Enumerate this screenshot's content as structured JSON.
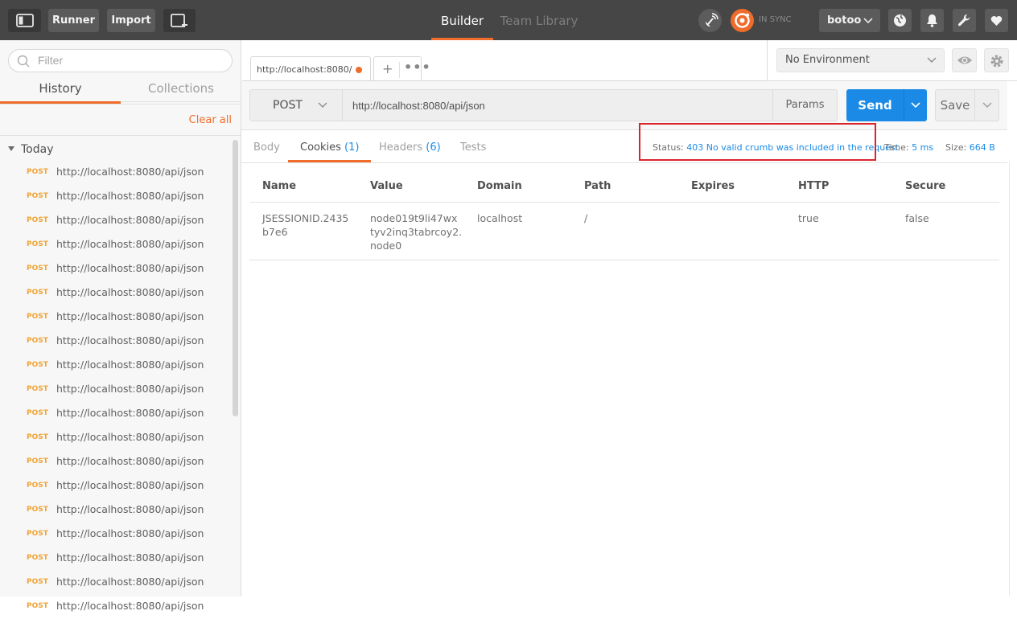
{
  "topbar": {
    "runner_label": "Runner",
    "import_label": "Import",
    "nav_tabs": [
      {
        "label": "Builder",
        "active": true
      },
      {
        "label": "Team Library",
        "active": false
      }
    ],
    "sync_label": "IN SYNC",
    "user_label": "botoo",
    "icons": [
      "sidebar-toggle-icon",
      "new-window-icon",
      "satellite-icon",
      "sync-icon",
      "globe-icon",
      "bell-icon",
      "wrench-icon",
      "heart-icon"
    ]
  },
  "sidebar": {
    "filter_placeholder": "Filter",
    "tabs": [
      {
        "label": "History",
        "active": true
      },
      {
        "label": "Collections",
        "active": false
      }
    ],
    "clear_all_label": "Clear all",
    "group_label": "Today",
    "history": [
      {
        "method": "POST",
        "url": "http://localhost:8080/api/json"
      },
      {
        "method": "POST",
        "url": "http://localhost:8080/api/json"
      },
      {
        "method": "POST",
        "url": "http://localhost:8080/api/json"
      },
      {
        "method": "POST",
        "url": "http://localhost:8080/api/json"
      },
      {
        "method": "POST",
        "url": "http://localhost:8080/api/json"
      },
      {
        "method": "POST",
        "url": "http://localhost:8080/api/json"
      },
      {
        "method": "POST",
        "url": "http://localhost:8080/api/json"
      },
      {
        "method": "POST",
        "url": "http://localhost:8080/api/json"
      },
      {
        "method": "POST",
        "url": "http://localhost:8080/api/json"
      },
      {
        "method": "POST",
        "url": "http://localhost:8080/api/json"
      },
      {
        "method": "POST",
        "url": "http://localhost:8080/api/json"
      },
      {
        "method": "POST",
        "url": "http://localhost:8080/api/json"
      },
      {
        "method": "POST",
        "url": "http://localhost:8080/api/json"
      },
      {
        "method": "POST",
        "url": "http://localhost:8080/api/json"
      },
      {
        "method": "POST",
        "url": "http://localhost:8080/api/json"
      },
      {
        "method": "POST",
        "url": "http://localhost:8080/api/json"
      },
      {
        "method": "POST",
        "url": "http://localhost:8080/api/json"
      },
      {
        "method": "POST",
        "url": "http://localhost:8080/api/json"
      },
      {
        "method": "POST",
        "url": "http://localhost:8080/api/json"
      }
    ]
  },
  "request": {
    "tab_label": "http://localhost:8080/",
    "new_tab_label": "+",
    "more_tabs_label": "•••",
    "method": "POST",
    "url": "http://localhost:8080/api/json",
    "params_label": "Params",
    "send_label": "Send",
    "save_label": "Save"
  },
  "environment": {
    "selected": "No Environment"
  },
  "response": {
    "tabs": [
      {
        "label": "Body",
        "count": ""
      },
      {
        "label": "Cookies",
        "count": "(1)"
      },
      {
        "label": "Headers",
        "count": "(6)"
      },
      {
        "label": "Tests",
        "count": ""
      }
    ],
    "status_label": "Status:",
    "status_value": "403 No valid crumb was included in the request",
    "time_label": "Time:",
    "time_value": "5 ms",
    "size_label": "Size:",
    "size_value": "664 B",
    "cookies": {
      "columns": [
        "Name",
        "Value",
        "Domain",
        "Path",
        "Expires",
        "HTTP",
        "Secure"
      ],
      "rows": [
        [
          "JSESSIONID.2435\nb7e6",
          "node019t9li47wx\ntyv2inq3tabrcoy2.\nnode0",
          "localhost",
          "/",
          "",
          "true",
          "false"
        ]
      ]
    }
  },
  "colors": {
    "accent": "#ef6c2a",
    "send": "#1a8ae6",
    "topbar": "#464646",
    "highlight_box": "#d9262d",
    "method_post": "#f0a435"
  }
}
